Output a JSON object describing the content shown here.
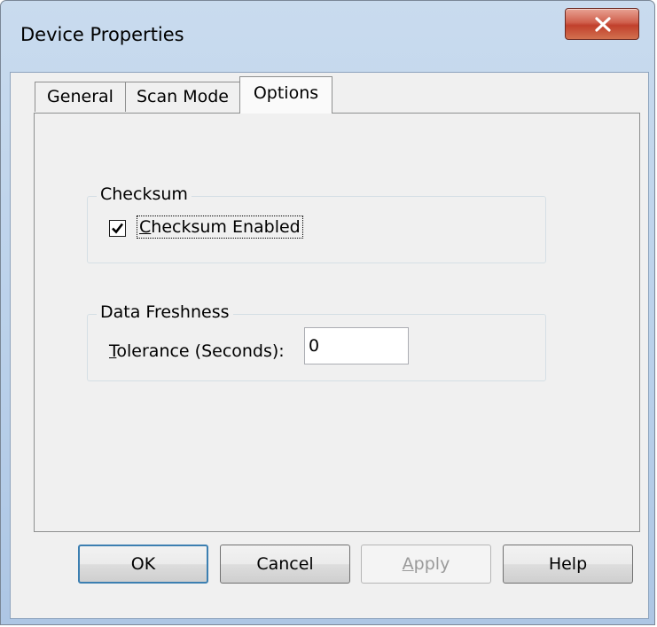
{
  "window": {
    "title": "Device Properties",
    "close_icon": "close-x-icon",
    "close_color": "#c7412e"
  },
  "tabs": [
    {
      "label": "General",
      "active": false
    },
    {
      "label": "Scan Mode",
      "active": false
    },
    {
      "label": "Options",
      "active": true
    }
  ],
  "checksum_group": {
    "title": "Checksum",
    "checkbox": {
      "mnemonic": "C",
      "label_rest": "hecksum Enabled",
      "checked": true
    }
  },
  "freshness_group": {
    "title": "Data Freshness",
    "tolerance": {
      "mnemonic": "T",
      "label_rest": "olerance (Seconds):",
      "value": "0"
    }
  },
  "buttons": {
    "ok": "OK",
    "cancel": "Cancel",
    "apply_mnemonic": "A",
    "apply_rest": "pply",
    "help": "Help"
  }
}
